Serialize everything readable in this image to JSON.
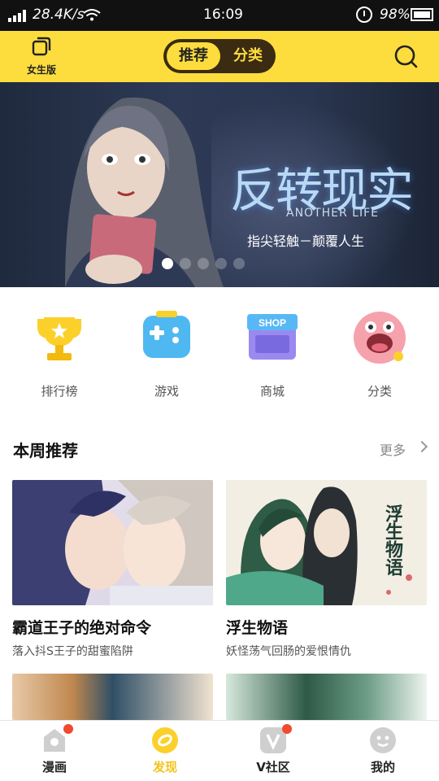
{
  "status_bar": {
    "speed": "28.4K/s",
    "time": "16:09",
    "battery": "98%"
  },
  "header": {
    "mode_label": "女生版",
    "toggle": {
      "left": "推荐",
      "right": "分类"
    }
  },
  "banner": {
    "title": "反转现实",
    "subtitle_en": "ANOTHER LIFE",
    "slogan": "指尖轻触－颠覆人生",
    "active_slide": 1,
    "slides": 5
  },
  "categories": [
    {
      "label": "排行榜",
      "icon": "trophy-icon"
    },
    {
      "label": "游戏",
      "icon": "gamepad-icon"
    },
    {
      "label": "商城",
      "icon": "shop-icon",
      "sign": "SHOP"
    },
    {
      "label": "分类",
      "icon": "category-face-icon"
    }
  ],
  "section": {
    "title": "本周推荐",
    "more": "更多"
  },
  "cards": [
    {
      "name": "霸道王子的绝对命令",
      "desc": "落入抖S王子的甜蜜陷阱"
    },
    {
      "name": "浮生物语",
      "desc": "妖怪荡气回肠的爱恨情仇",
      "art_text": "浮生物语"
    }
  ],
  "tabs": [
    {
      "label": "漫画",
      "icon": "manga-home-icon",
      "badge": true
    },
    {
      "label": "发现",
      "icon": "discover-icon",
      "active": true
    },
    {
      "label": "V社区",
      "icon": "community-icon",
      "badge": true
    },
    {
      "label": "我的",
      "icon": "profile-icon"
    }
  ],
  "colors": {
    "brand_yellow": "#fddd3d",
    "toggle_dark": "#3b2b12",
    "badge_red": "#f04a2f"
  }
}
